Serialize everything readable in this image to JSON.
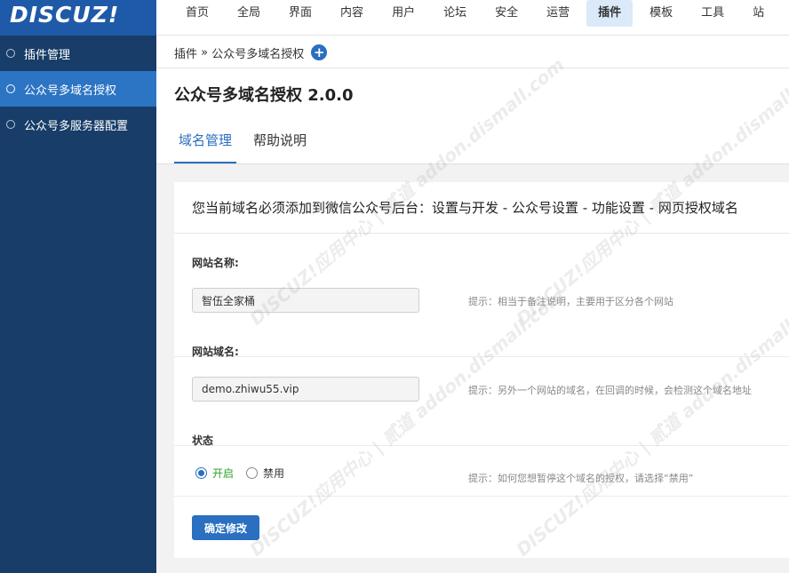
{
  "logo": "DISCUZ!",
  "nav": [
    "首页",
    "全局",
    "界面",
    "内容",
    "用户",
    "论坛",
    "安全",
    "运营",
    "插件",
    "模板",
    "工具",
    "站"
  ],
  "nav_active_index": 8,
  "sidebar": {
    "items": [
      {
        "label": "插件管理",
        "active": false
      },
      {
        "label": "公众号多域名授权",
        "active": true
      },
      {
        "label": "公众号多服务器配置",
        "active": false
      }
    ]
  },
  "breadcrumb": {
    "root": "插件",
    "sep": " » ",
    "current": "公众号多域名授权",
    "add_icon": "+"
  },
  "page_title": "公众号多域名授权 2.0.0",
  "tabs": [
    {
      "label": "域名管理",
      "active": true
    },
    {
      "label": "帮助说明",
      "active": false
    }
  ],
  "notice": "您当前域名必须添加到微信公众号后台：设置与开发 - 公众号设置 - 功能设置 - 网页授权域名",
  "form": {
    "site_name": {
      "label": "网站名称:",
      "value": "智伍全家桶",
      "hint": "提示：相当于备注说明，主要用于区分各个网站"
    },
    "site_domain": {
      "label": "网站域名:",
      "value": "demo.zhiwu55.vip",
      "hint": "提示：另外一个网站的域名，在回调的时候，会检测这个域名地址"
    },
    "status": {
      "label": "状态",
      "on_label": "开启",
      "off_label": "禁用",
      "value": "on",
      "hint": "提示：如何您想暂停这个域名的授权，请选择“禁用”"
    },
    "submit_label": "确定修改"
  },
  "watermark": "DISCUZ!应用中心 | 贰道 addon.dismall.com",
  "colors": {
    "sidebar": "#173d68",
    "sidebar_active": "#2c74c4",
    "primary": "#2a6fc0",
    "on_green": "#2ea12e"
  }
}
